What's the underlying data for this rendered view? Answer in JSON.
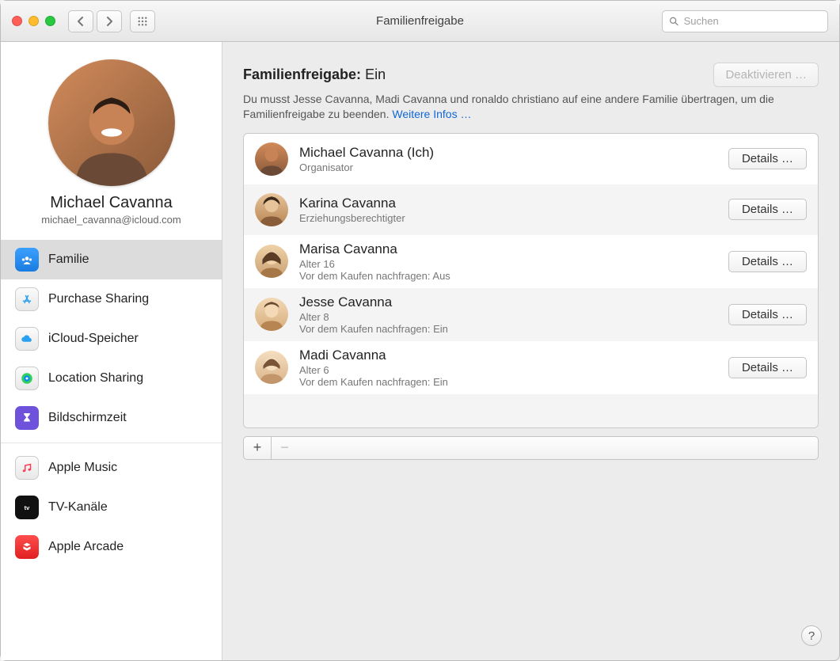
{
  "window": {
    "title": "Familienfreigabe"
  },
  "search": {
    "placeholder": "Suchen"
  },
  "user": {
    "name": "Michael Cavanna",
    "email": "michael_cavanna@icloud.com"
  },
  "sidebar": {
    "items": [
      {
        "label": "Familie"
      },
      {
        "label": "Purchase Sharing"
      },
      {
        "label": "iCloud-Speicher"
      },
      {
        "label": "Location Sharing"
      },
      {
        "label": "Bildschirmzeit"
      },
      {
        "label": "Apple Music"
      },
      {
        "label": "TV-Kanäle"
      },
      {
        "label": "Apple Arcade"
      }
    ]
  },
  "main": {
    "heading_label": "Familienfreigabe:",
    "heading_state": "Ein",
    "deactivate_label": "Deaktivieren …",
    "subtext": "Du musst Jesse Cavanna, Madi Cavanna und ronaldo christiano auf eine andere Familie übertragen, um die Familienfreigabe zu beenden.",
    "more_info_label": "Weitere Infos …",
    "details_label": "Details …",
    "members": [
      {
        "name": "Michael Cavanna (Ich)",
        "role": "Organisator"
      },
      {
        "name": "Karina Cavanna",
        "role": "Erziehungsberechtigter"
      },
      {
        "name": "Marisa Cavanna",
        "role": "Alter 16",
        "extra": "Vor dem Kaufen nachfragen: Aus"
      },
      {
        "name": "Jesse Cavanna",
        "role": "Alter 8",
        "extra": "Vor dem Kaufen nachfragen: Ein"
      },
      {
        "name": "Madi Cavanna",
        "role": "Alter 6",
        "extra": "Vor dem Kaufen nachfragen: Ein"
      }
    ],
    "add_label": "+",
    "remove_label": "−",
    "help_label": "?"
  }
}
